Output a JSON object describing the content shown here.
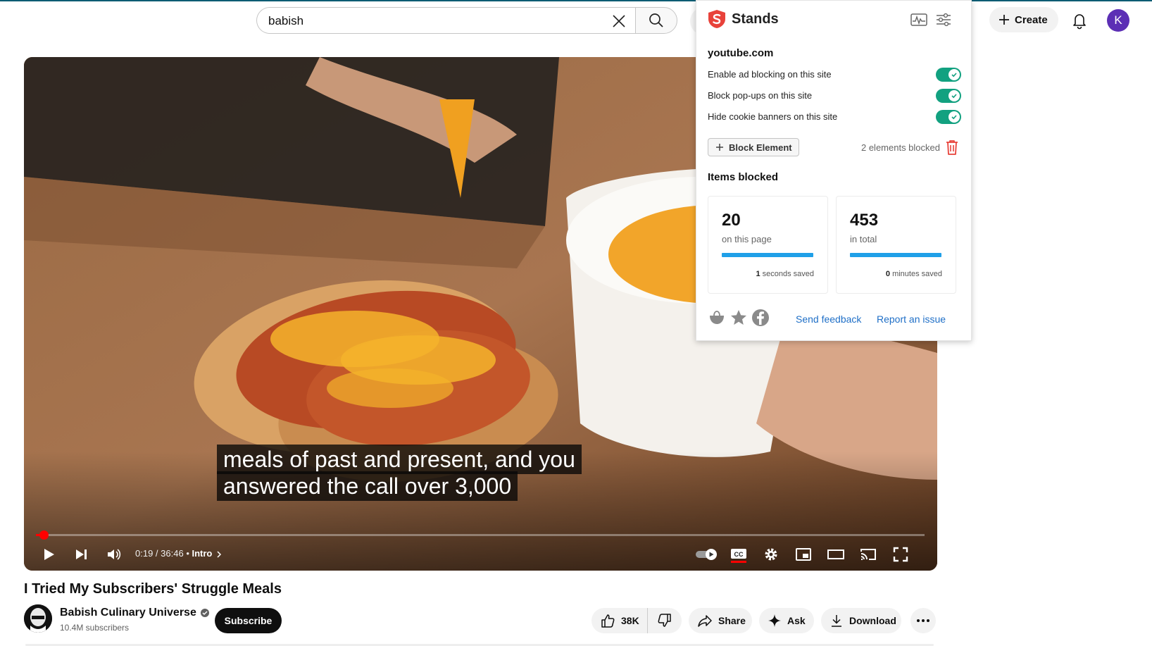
{
  "header": {
    "search_value": "babish",
    "create_label": "Create",
    "avatar_letter": "K",
    "icons": [
      "clear-search-icon",
      "search-icon",
      "microphone-icon",
      "plus-icon",
      "bell-icon"
    ]
  },
  "player": {
    "caption_line1": "meals of past and present, and you",
    "caption_line2": "answered the call over 3,000",
    "time_current": "0:19",
    "time_separator": " / ",
    "time_total": "36:46",
    "chapter_separator": " • ",
    "chapter": "Intro",
    "progress_fraction": 0.0086,
    "icons": [
      "play-icon",
      "next-icon",
      "volume-icon",
      "chevron-right-icon",
      "autoplay-toggle-icon",
      "closed-captions-icon",
      "settings-gear-icon",
      "miniplayer-icon",
      "theater-mode-icon",
      "cast-icon",
      "fullscreen-icon"
    ]
  },
  "video": {
    "title": "I Tried My Subscribers' Struggle Meals",
    "channel_name": "Babish Culinary Universe",
    "subscribers": "10.4M subscribers",
    "subscribe_label": "Subscribe",
    "likes": "38K",
    "share_label": "Share",
    "ask_label": "Ask",
    "download_label": "Download"
  },
  "extension": {
    "name": "Stands",
    "site": "youtube.com",
    "toggles": [
      {
        "label": "Enable ad blocking on this site",
        "on": true
      },
      {
        "label": "Block pop-ups on this site",
        "on": true
      },
      {
        "label": "Hide cookie banners on this site",
        "on": true
      }
    ],
    "block_element_label": "Block Element",
    "elements_blocked": "2 elements blocked",
    "items_blocked_heading": "Items blocked",
    "page_count": "20",
    "page_label": "on this page",
    "page_saved_value": "1",
    "page_saved_unit": " seconds saved",
    "total_count": "453",
    "total_label": "in total",
    "total_saved_value": "0",
    "total_saved_unit": " minutes saved",
    "send_feedback": "Send feedback",
    "report_issue": "Report an issue",
    "accent_color": "#e8423a",
    "toggle_color": "#12a180",
    "bar_color": "#1fa0e8",
    "link_color": "#1f6fc7"
  }
}
